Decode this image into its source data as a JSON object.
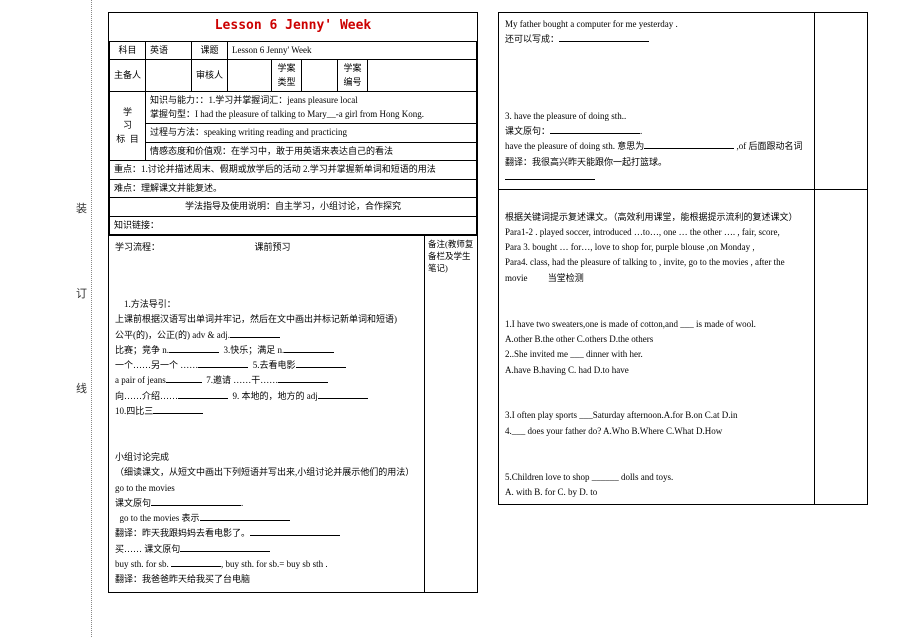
{
  "title": "Lesson 6 Jenny' Week",
  "margin": {
    "zhuang": "装",
    "ding": "订",
    "xian": "线"
  },
  "meta": {
    "subject_lbl": "科目",
    "subject": "英语",
    "topic_lbl": "课题",
    "topic": "Lesson 6 Jenny' Week",
    "author_lbl": "主备人",
    "author": "",
    "reviewer_lbl": "审核人",
    "reviewer": "",
    "type_lbl": "学案类型",
    "type": "",
    "num_lbl": "学案编号",
    "num": ""
  },
  "goal": {
    "lbl": "学习目标",
    "r1a": "知识与能力：：1.学习并掌握词汇：jeans  pleasure  local",
    "r1b": "掌握句型：I had the pleasure of talking to Mary__-a girl from Hong Kong.",
    "r2": "过程与方法：speaking   writing  reading and practicing",
    "r3": "情感态度和价值观：在学习中，敢于用英语来表达自己的看法"
  },
  "keypt": {
    "lbl": "重点：",
    "txt": "1.讨论并描述周末、假期或放学后的活动 2.学习并掌握新单词和短语的用法"
  },
  "diff": {
    "lbl": "难点：",
    "txt": "理解课文并能复述。"
  },
  "method": {
    "lbl1": "学法指导及使用说明：",
    "txt1": "自主学习，小组讨论，合作探究",
    "lbl2": "知识链接："
  },
  "flow": {
    "lbl": "学习流程：",
    "pre": "课前预习",
    "sidenote": "备注(教师复备栏及学生笔记)"
  },
  "p1": {
    "t1": "1.方法导引：",
    "t2": "上课前根据汉语写出单词并牢记，然后在文中画出并标记新单词和短语)",
    "l1a": "公平(的)，公正(的) adv & adj.",
    "l2a": "比赛；竞争 n.",
    "l2b": "3.快乐；满足 n.",
    "l3a": "一个……另一个 ……",
    "l3b": "5.去看电影",
    "l4a": "a pair of jeans",
    "l4b": "7.邀请 ……干……",
    "l5a": "向……介绍……",
    "l5b": "9. 本地的，地方的 adj",
    "l6": "10.四比三"
  },
  "p2": {
    "t1": "小组讨论完成",
    "t2": "（细读课文，从短文中画出下列短语并写出来,小组讨论并展示他们的用法）",
    "l1": "go to the movies",
    "l2": "课文原句",
    "l3": "go to the movies 表示",
    "l4": "翻译：昨天我跟妈妈去看电影了。",
    "l5": "买……  课文原句",
    "l6": "buy sth. for sb. ",
    "l6b": ", buy sth. for sb.= buy sb sth .",
    "l7": "翻译：我爸爸昨天给我买了台电脑"
  },
  "right": {
    "r1": "My father bought a computer for me yesterday .",
    "r2": "还可以写成：",
    "r3": "3.  have the pleasure of doing sth..",
    "r4": "课文原句：",
    "r5a": "have the pleasure of doing sth. 意思为",
    "r5b": ",of 后面跟动名词",
    "r6": "翻译：我很高兴昨天能跟你一起打篮球。",
    "r7": "根据关键词提示复述课文。（高效利用课堂，能根据提示流利的复述课文）",
    "r8": "Para1-2 . played soccer, introduced …to…, one … the other …. , fair, score,",
    "r9": "Para 3. bought  … for…,  love to shop for,  purple blouse ,on Monday ,",
    "r10a": "Para4. class, had the pleasure of talking to , invite, go to the movies , after the movie",
    "r10b": "当堂检测",
    "q1": "1.I have two sweaters,one is made of cotton,and ___ is made of wool.",
    "q1o": "  A.other B.the other C.others  D.the others",
    "q21": " 2..She invited me ___ dinner with her.",
    "q22": "  A.have   B.having   C. had  D.to have",
    "q3": "3.I often play sports ___Saturday afternoon.A.for   B.on   C.at   D.in",
    "q4": "4.___ does your father do?  A.Who   B.Where   C.What   D.How",
    "q5": "5.Children love to shop ______ dolls and toys.",
    "q5o": "  A. with    B. for         C. by    D. to"
  }
}
